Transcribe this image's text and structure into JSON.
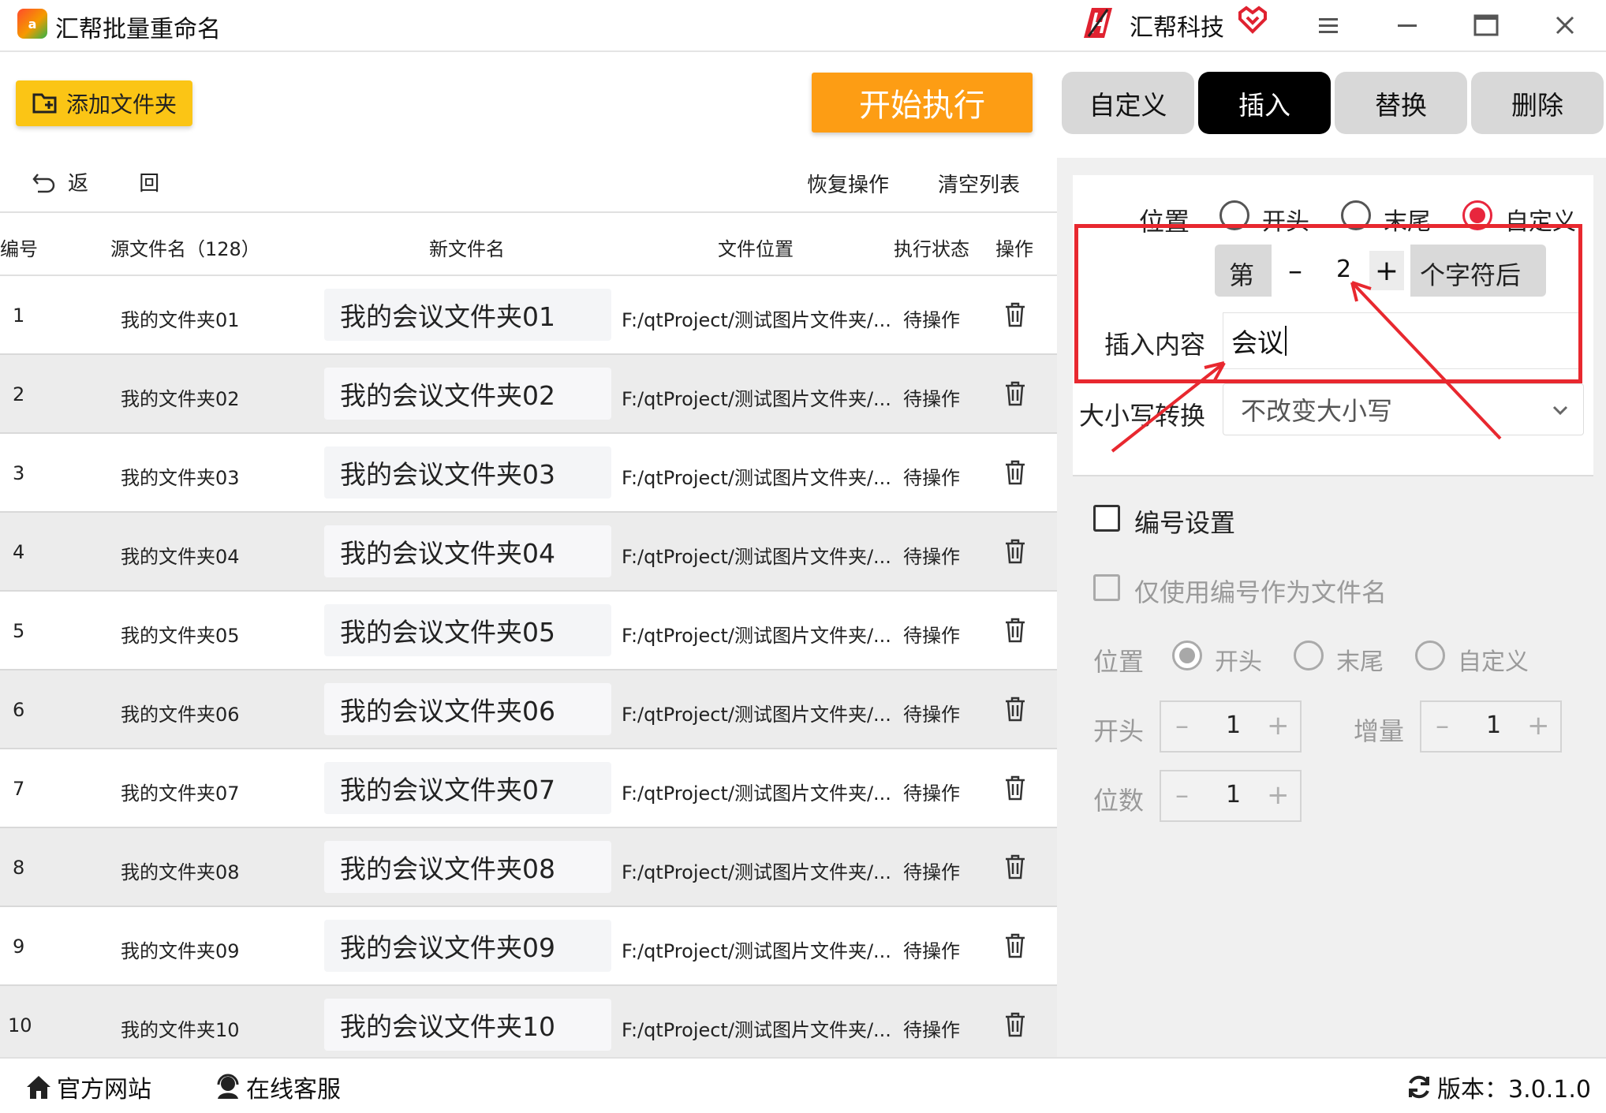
{
  "app": {
    "title": "汇帮批量重命名",
    "logo_text": "a",
    "brand": "汇帮科技"
  },
  "window_controls": [
    "menu-icon",
    "minimize-icon",
    "maximize-icon",
    "close-icon"
  ],
  "toolbar": {
    "add_folder": "添加文件夹",
    "start": "开始执行"
  },
  "tabs": [
    {
      "label": "自定义",
      "active": false
    },
    {
      "label": "插入",
      "active": true
    },
    {
      "label": "替换",
      "active": false
    },
    {
      "label": "删除",
      "active": false
    }
  ],
  "list_actions": {
    "back": "返 回",
    "restore": "恢复操作",
    "clear": "清空列表"
  },
  "table": {
    "headers": {
      "num": "编号",
      "source": "源文件名（128）",
      "newname": "新文件名",
      "location": "文件位置",
      "status": "执行状态",
      "action": "操作"
    },
    "rows": [
      {
        "num": "1",
        "source": "我的文件夹01",
        "newname": "我的会议文件夹01",
        "location": "F:/qtProject/测试图片文件夹/...",
        "status": "待操作"
      },
      {
        "num": "2",
        "source": "我的文件夹02",
        "newname": "我的会议文件夹02",
        "location": "F:/qtProject/测试图片文件夹/...",
        "status": "待操作"
      },
      {
        "num": "3",
        "source": "我的文件夹03",
        "newname": "我的会议文件夹03",
        "location": "F:/qtProject/测试图片文件夹/...",
        "status": "待操作"
      },
      {
        "num": "4",
        "source": "我的文件夹04",
        "newname": "我的会议文件夹04",
        "location": "F:/qtProject/测试图片文件夹/...",
        "status": "待操作"
      },
      {
        "num": "5",
        "source": "我的文件夹05",
        "newname": "我的会议文件夹05",
        "location": "F:/qtProject/测试图片文件夹/...",
        "status": "待操作"
      },
      {
        "num": "6",
        "source": "我的文件夹06",
        "newname": "我的会议文件夹06",
        "location": "F:/qtProject/测试图片文件夹/...",
        "status": "待操作"
      },
      {
        "num": "7",
        "source": "我的文件夹07",
        "newname": "我的会议文件夹07",
        "location": "F:/qtProject/测试图片文件夹/...",
        "status": "待操作"
      },
      {
        "num": "8",
        "source": "我的文件夹08",
        "newname": "我的会议文件夹08",
        "location": "F:/qtProject/测试图片文件夹/...",
        "status": "待操作"
      },
      {
        "num": "9",
        "source": "我的文件夹09",
        "newname": "我的会议文件夹09",
        "location": "F:/qtProject/测试图片文件夹/...",
        "status": "待操作"
      },
      {
        "num": "10",
        "source": "我的文件夹10",
        "newname": "我的会议文件夹10",
        "location": "F:/qtProject/测试图片文件夹/...",
        "status": "待操作"
      }
    ]
  },
  "insert_panel": {
    "position_label": "位置",
    "position_options": [
      "开头",
      "末尾",
      "自定义"
    ],
    "position_selected": "自定义",
    "nth_prefix": "第",
    "nth_value": "2",
    "nth_suffix": "个字符后",
    "content_label": "插入内容",
    "content_value": "会议",
    "case_label": "大小写转换",
    "case_value": "不改变大小写"
  },
  "numbering": {
    "enable_label": "编号设置",
    "only_number_label": "仅使用编号作为文件名",
    "position_label": "位置",
    "position_options": [
      "开头",
      "末尾",
      "自定义"
    ],
    "position_selected": "开头",
    "start_label": "开头",
    "start_value": "1",
    "step_label": "增量",
    "step_value": "1",
    "digits_label": "位数",
    "digits_value": "1"
  },
  "footer": {
    "website": "官方网站",
    "support": "在线客服",
    "version": "版本：3.0.1.0"
  },
  "colors": {
    "accent_yellow": "#fbc515",
    "start_orange": "#fd9d14",
    "annotation_red": "#e8282f",
    "radio_red": "#e8263d"
  }
}
